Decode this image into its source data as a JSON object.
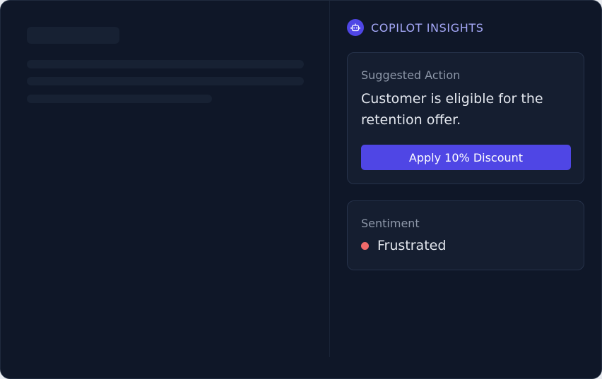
{
  "copilot": {
    "title": "COPILOT INSIGHTS",
    "icon": "bot-icon",
    "accent_color": "#4f46e5"
  },
  "suggested_action": {
    "label": "Suggested Action",
    "text": "Customer is eligible for the retention offer.",
    "button_label": "Apply 10% Discount"
  },
  "sentiment": {
    "label": "Sentiment",
    "value": "Frustrated",
    "status_color": "#f06a6a"
  }
}
